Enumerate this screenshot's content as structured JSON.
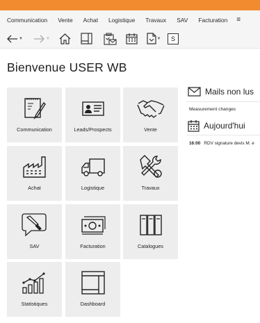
{
  "menu": {
    "items": [
      {
        "label": "Communication"
      },
      {
        "label": "Vente"
      },
      {
        "label": "Achat"
      },
      {
        "label": "Logistique"
      },
      {
        "label": "Travaux"
      },
      {
        "label": "SAV"
      },
      {
        "label": "Facturation"
      }
    ],
    "more_icon": "hamburger-icon"
  },
  "toolbar": {
    "back_icon": "arrow-left-icon",
    "forward_icon": "arrow-right-icon",
    "home_icon": "home-icon",
    "s_label": "S"
  },
  "page": {
    "title": "Bienvenue USER WB"
  },
  "tiles": [
    {
      "label": "Communication",
      "icon": "notepad-pen-icon"
    },
    {
      "label": "Leads/Prospects",
      "icon": "id-card-icon"
    },
    {
      "label": "Vente",
      "icon": "handshake-icon"
    },
    {
      "label": "Achat",
      "icon": "factory-icon"
    },
    {
      "label": "Logistique",
      "icon": "truck-icon"
    },
    {
      "label": "Travaux",
      "icon": "tools-icon"
    },
    {
      "label": "SAV",
      "icon": "screwdriver-icon"
    },
    {
      "label": "Facturation",
      "icon": "banknotes-icon"
    },
    {
      "label": "Catalogues",
      "icon": "binders-icon"
    },
    {
      "label": "Statistiques",
      "icon": "bar-chart-icon"
    },
    {
      "label": "Dashboard",
      "icon": "dashboard-icon"
    }
  ],
  "mail": {
    "title": "Mails non lus",
    "items": [
      {
        "subject": "Measurement changes"
      }
    ]
  },
  "today": {
    "title": "Aujourd'hui",
    "events": [
      {
        "time": "16:00",
        "text": "RDV signature devis M. e"
      }
    ]
  },
  "colors": {
    "accent": "#f28a30",
    "tile_bg": "#ededed",
    "bar_bg": "#f5f5f5"
  }
}
